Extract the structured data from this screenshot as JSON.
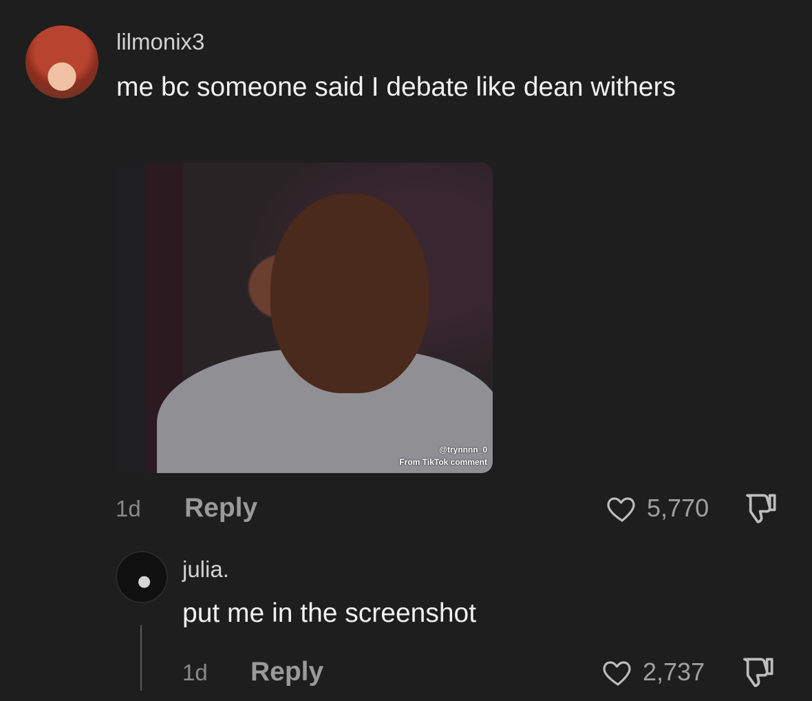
{
  "comments": [
    {
      "username": "lilmonix3",
      "text": "me bc someone said I debate like dean withers",
      "time": "1d",
      "reply_label": "Reply",
      "likes": "5,770",
      "media": {
        "watermark_handle": "@trynnnn_0",
        "watermark_source": "From TikTok comment"
      }
    },
    {
      "username": "julia.",
      "text": "put me in the screenshot",
      "time": "1d",
      "reply_label": "Reply",
      "likes": "2,737"
    }
  ],
  "icons": {
    "like": "heart-outline-icon",
    "dislike": "thumbs-down-icon"
  },
  "colors": {
    "background": "#1e1e1e",
    "text": "#f1f1f1",
    "muted": "#8a8a8a"
  }
}
